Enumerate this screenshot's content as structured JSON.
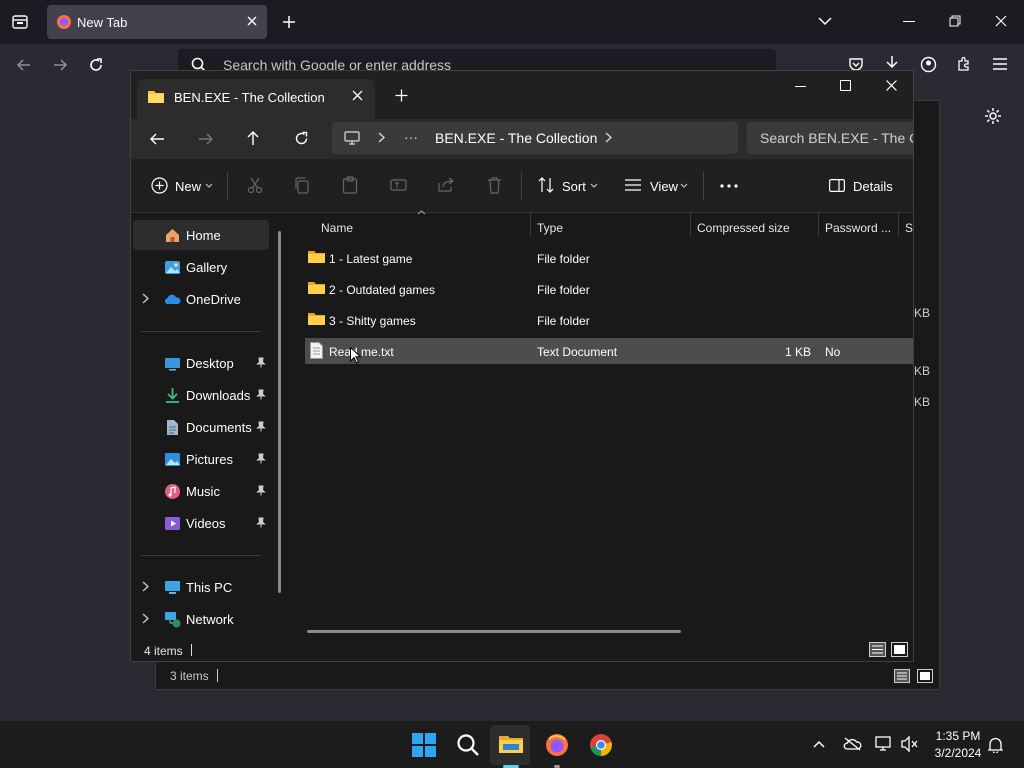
{
  "firefox": {
    "tab_title": "New Tab",
    "url_placeholder": "Search with Google or enter address"
  },
  "background_explorer": {
    "status_count": "3 items",
    "partial_sizes": [
      "KB",
      "KB",
      "KB"
    ]
  },
  "explorer": {
    "tab_title": "BEN.EXE - The Collection",
    "breadcrumb": "BEN.EXE - The Collection",
    "search_placeholder": "Search BEN.EXE - The Collection",
    "toolbar": {
      "new_label": "New",
      "sort_label": "Sort",
      "view_label": "View",
      "details_label": "Details"
    },
    "sidebar": {
      "quick": [
        {
          "label": "Home",
          "icon": "home-icon",
          "selected": true
        },
        {
          "label": "Gallery",
          "icon": "gallery-icon"
        },
        {
          "label": "OneDrive",
          "icon": "onedrive-icon",
          "expandable": true
        }
      ],
      "pinned": [
        {
          "label": "Desktop",
          "icon": "desktop-icon"
        },
        {
          "label": "Downloads",
          "icon": "downloads-icon"
        },
        {
          "label": "Documents",
          "icon": "documents-icon"
        },
        {
          "label": "Pictures",
          "icon": "pictures-icon"
        },
        {
          "label": "Music",
          "icon": "music-icon"
        },
        {
          "label": "Videos",
          "icon": "videos-icon"
        }
      ],
      "locations": [
        {
          "label": "This PC",
          "icon": "this-pc-icon"
        },
        {
          "label": "Network",
          "icon": "network-icon"
        }
      ]
    },
    "columns": [
      "Name",
      "Type",
      "Compressed size",
      "Password ...",
      "Si"
    ],
    "files": [
      {
        "name": "1 - Latest game",
        "type": "File folder",
        "size": "",
        "password": "",
        "icon": "folder-icon"
      },
      {
        "name": "2 - Outdated games",
        "type": "File folder",
        "size": "",
        "password": "",
        "icon": "folder-icon"
      },
      {
        "name": "3 - Shitty games",
        "type": "File folder",
        "size": "",
        "password": "",
        "icon": "folder-icon"
      },
      {
        "name": "Read me.txt",
        "type": "Text Document",
        "size": "1 KB",
        "password": "No",
        "icon": "text-file-icon",
        "selected": true
      }
    ],
    "status_count": "4 items"
  },
  "taskbar": {
    "time": "1:35 PM",
    "date": "3/2/2024"
  }
}
